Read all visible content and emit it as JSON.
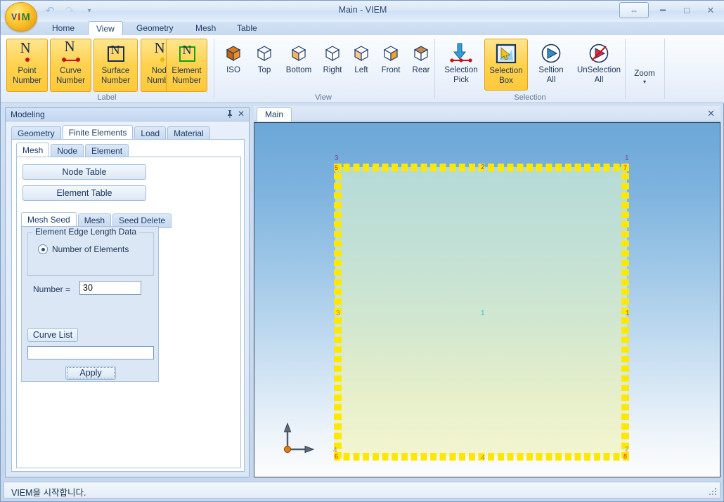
{
  "window": {
    "title": "Main - VIEM",
    "orb": {
      "v": "V",
      "i": "I",
      "m": "M"
    },
    "quick_access": [
      {
        "name": "undo-icon",
        "glyph": "↶"
      },
      {
        "name": "redo-icon",
        "glyph": "↷"
      },
      {
        "name": "customize-qat-icon",
        "glyph": "▾"
      }
    ],
    "controls": {
      "help_glyph": "⇔",
      "minimize_glyph": "━",
      "maximize_glyph": "□",
      "close_glyph": "✕"
    }
  },
  "ribbon": {
    "tabs": [
      {
        "label": "Home",
        "active": false
      },
      {
        "label": "View",
        "active": true
      },
      {
        "label": "Geometry",
        "active": false
      },
      {
        "label": "Mesh",
        "active": false
      },
      {
        "label": "Table",
        "active": false
      }
    ],
    "groups": [
      {
        "name": "label",
        "title": "Label",
        "buttons": [
          {
            "label1": "Point",
            "label2": "Number",
            "icon": "point-number-icon",
            "highlighted": true
          },
          {
            "label1": "Curve",
            "label2": "Number",
            "icon": "curve-number-icon",
            "highlighted": true
          },
          {
            "label1": "Surface",
            "label2": "Number",
            "icon": "surface-number-icon",
            "highlighted": true
          },
          {
            "label1": "Node",
            "label2": "Number",
            "icon": "node-number-icon",
            "highlighted": true
          },
          {
            "label1": "Element",
            "label2": "Number",
            "icon": "element-number-icon",
            "highlighted": true
          }
        ]
      },
      {
        "name": "view",
        "title": "View",
        "buttons": [
          {
            "label1": "ISO",
            "label2": "",
            "icon": "view-iso-icon",
            "highlighted": false
          },
          {
            "label1": "Top",
            "label2": "",
            "icon": "view-top-icon",
            "highlighted": false
          },
          {
            "label1": "Bottom",
            "label2": "",
            "icon": "view-bottom-icon",
            "highlighted": false
          },
          {
            "label1": "Right",
            "label2": "",
            "icon": "view-right-icon",
            "highlighted": false
          },
          {
            "label1": "Left",
            "label2": "",
            "icon": "view-left-icon",
            "highlighted": false
          },
          {
            "label1": "Front",
            "label2": "",
            "icon": "view-front-icon",
            "highlighted": false
          },
          {
            "label1": "Rear",
            "label2": "",
            "icon": "view-rear-icon",
            "highlighted": false
          }
        ]
      },
      {
        "name": "selection",
        "title": "Selection",
        "buttons": [
          {
            "label1": "Selection",
            "label2": "Pick",
            "icon": "selection-pick-icon",
            "highlighted": false
          },
          {
            "label1": "Selection",
            "label2": "Box",
            "icon": "selection-box-icon",
            "highlighted": true
          },
          {
            "label1": "Seltion",
            "label2": "All",
            "icon": "selection-all-icon",
            "highlighted": false
          },
          {
            "label1": "UnSelection",
            "label2": "All",
            "icon": "unselection-all-icon",
            "highlighted": false
          }
        ]
      },
      {
        "name": "zoom",
        "title": "",
        "buttons": [
          {
            "label1": "Zoom",
            "label2": "▾",
            "icon": "zoom-dropdown-icon",
            "highlighted": false
          }
        ]
      }
    ]
  },
  "modeling_panel": {
    "title": "Modeling",
    "pin_glyph": "⚓",
    "close_glyph": "✕",
    "tabs_level1": [
      {
        "label": "Geometry",
        "active": false
      },
      {
        "label": "Finite Elements",
        "active": true
      },
      {
        "label": "Load",
        "active": false
      },
      {
        "label": "Material",
        "active": false
      }
    ],
    "tabs_level2": [
      {
        "label": "Mesh",
        "active": true
      },
      {
        "label": "Node",
        "active": false
      },
      {
        "label": "Element",
        "active": false
      }
    ],
    "buttons": [
      {
        "label": "Node Table"
      },
      {
        "label": "Element Table"
      }
    ],
    "tabs_level3": [
      {
        "label": "Mesh Seed",
        "active": true
      },
      {
        "label": "Mesh",
        "active": false
      },
      {
        "label": "Seed Delete",
        "active": false
      }
    ],
    "mesh_seed": {
      "groupbox_title": "Element Edge Length Data",
      "radio_label": "Number of Elements",
      "radio_selected": true,
      "number_label": "Number =",
      "number_value": "30",
      "curve_list_label": "Curve List",
      "curve_list_value": "",
      "apply_label": "Apply"
    }
  },
  "viewport": {
    "tabs": [
      {
        "label": "Main",
        "active": true
      }
    ],
    "close_glyph": "✕",
    "mesh": {
      "seed_count": 30,
      "surface_label": "1",
      "edge_labels": [
        {
          "text": "2",
          "position": "top-mid",
          "color": "#7a3fb0"
        },
        {
          "text": "4",
          "position": "bottom-mid",
          "color": "#b08a18"
        },
        {
          "text": "3",
          "position": "left-mid",
          "color": "#b08a18"
        },
        {
          "text": "1",
          "position": "right-mid",
          "color": "#b84040"
        }
      ],
      "corner_labels": [
        {
          "text": "3",
          "position": "top-left",
          "color": "#7a3fb0"
        },
        {
          "text": "1",
          "position": "top-right",
          "color": "#7a3fb0"
        },
        {
          "text": "4",
          "position": "bottom-left",
          "color": "#b08a18"
        },
        {
          "text": "2",
          "position": "bottom-right",
          "color": "#b08a18"
        }
      ],
      "point_markers": [
        {
          "text": "5",
          "position": "top-left"
        },
        {
          "text": "7",
          "position": "top-right"
        },
        {
          "text": "6",
          "position": "bottom-left"
        },
        {
          "text": "8",
          "position": "bottom-right"
        }
      ]
    },
    "axis_indicator": {
      "name": "axis-triad",
      "up": "Y",
      "right": "X"
    }
  },
  "status": {
    "message": "VIEM을 시작합니다."
  },
  "colors": {
    "mesh_yellow": "#ffe800",
    "highlight_orange": "#ffc83a",
    "frame_blue": "#8fb0d2",
    "surface_teal": "#c4e2d4"
  }
}
